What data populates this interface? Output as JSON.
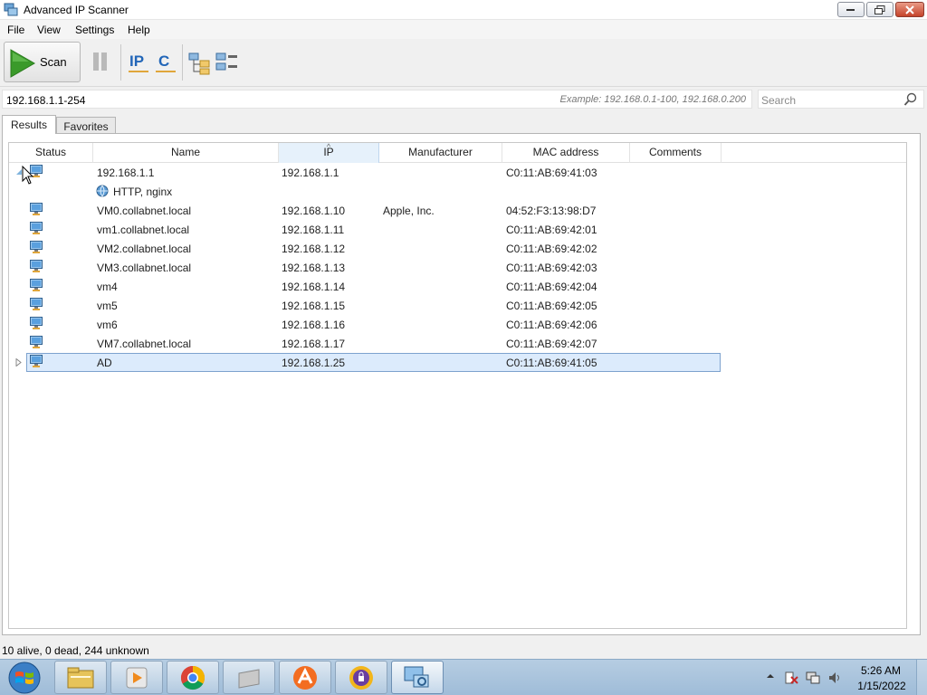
{
  "window": {
    "title": "Advanced IP Scanner"
  },
  "menu": [
    "File",
    "View",
    "Settings",
    "Help"
  ],
  "toolbar": {
    "scan_label": "Scan"
  },
  "address_bar": {
    "value": "192.168.1.1-254",
    "example": "Example: 192.168.0.1-100, 192.168.0.200"
  },
  "search": {
    "placeholder": "Search"
  },
  "tabs": [
    "Results",
    "Favorites"
  ],
  "grid": {
    "columns": [
      "Status",
      "Name",
      "IP",
      "Manufacturer",
      "MAC address",
      "Comments"
    ],
    "sorted_column": "IP",
    "rows": [
      {
        "name": "192.168.1.1",
        "ip": "192.168.1.1",
        "manufacturer": "",
        "mac": "C0:11:AB:69:41:03",
        "expanded": true,
        "service": "HTTP, nginx"
      },
      {
        "name": "VM0.collabnet.local",
        "ip": "192.168.1.10",
        "manufacturer": "Apple, Inc.",
        "mac": "04:52:F3:13:98:D7"
      },
      {
        "name": "vm1.collabnet.local",
        "ip": "192.168.1.11",
        "manufacturer": "",
        "mac": "C0:11:AB:69:42:01"
      },
      {
        "name": "VM2.collabnet.local",
        "ip": "192.168.1.12",
        "manufacturer": "",
        "mac": "C0:11:AB:69:42:02"
      },
      {
        "name": "VM3.collabnet.local",
        "ip": "192.168.1.13",
        "manufacturer": "",
        "mac": "C0:11:AB:69:42:03"
      },
      {
        "name": "vm4",
        "ip": "192.168.1.14",
        "manufacturer": "",
        "mac": "C0:11:AB:69:42:04"
      },
      {
        "name": "vm5",
        "ip": "192.168.1.15",
        "manufacturer": "",
        "mac": "C0:11:AB:69:42:05"
      },
      {
        "name": "vm6",
        "ip": "192.168.1.16",
        "manufacturer": "",
        "mac": "C0:11:AB:69:42:06"
      },
      {
        "name": "VM7.collabnet.local",
        "ip": "192.168.1.17",
        "manufacturer": "",
        "mac": "C0:11:AB:69:42:07"
      },
      {
        "name": "AD",
        "ip": "192.168.1.25",
        "manufacturer": "",
        "mac": "C0:11:AB:69:41:05",
        "selected": true
      }
    ]
  },
  "status": {
    "text": "10 alive, 0 dead, 244 unknown"
  },
  "taskbar": {
    "pinned": [
      "windows-explorer-icon",
      "media-player-icon",
      "chrome-icon",
      "virtual-drive-icon",
      "avast-icon",
      "vpn-shield-icon",
      "advanced-ip-scanner-icon"
    ],
    "clock_time": "5:26 AM",
    "clock_date": "1/15/2022"
  },
  "colors": {
    "accent": "#3a9a2a",
    "selection": "#dcebfc",
    "taskbar": "#a9c3dd"
  }
}
